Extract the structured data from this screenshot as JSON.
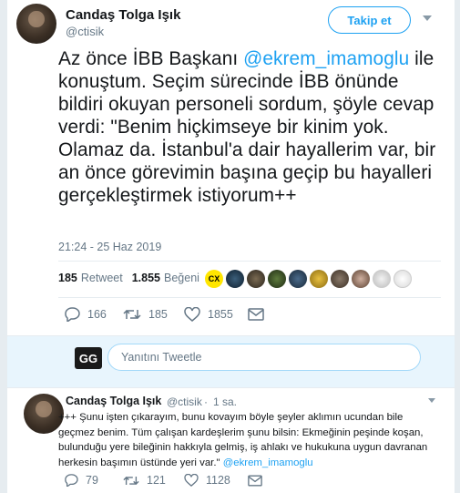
{
  "main_tweet": {
    "author_name": "Candaş Tolga Işık",
    "author_handle": "@ctisik",
    "follow_label": "Takip et",
    "text_before": "Az önce İBB Başkanı ",
    "mention": "@ekrem_imamoglu",
    "text_after": " ile konuştum. Seçim sürecinde İBB önünde bildiri okuyan personeli sordum, şöyle cevap verdi: \"Benim hiçkimseye bir kinim yok. Olamaz da. İstanbul'a dair hayallerim var, bir an önce görevimin başına geçip bu hayalleri gerçekleştirmek istiyorum++",
    "timestamp": "21:24 - 25 Haz 2019",
    "retweets_count": "185",
    "retweets_label": "Retweet",
    "likes_count": "1.855",
    "likes_label": "Beğeni",
    "liker_badge": "CX",
    "actions": {
      "reply": "166",
      "retweet": "185",
      "like": "1855"
    }
  },
  "reply_box": {
    "avatar_text": "GG",
    "placeholder": "Yanıtını Tweetle"
  },
  "reply_tweet": {
    "author_name": "Candaş Tolga Işık",
    "author_handle": "@ctisik",
    "time_ago": "1 sa.",
    "text": "+++ Şunu işten çıkarayım, bunu kovayım böyle şeyler aklımın ucundan bile geçmez benim. Tüm çalışan kardeşlerim şunu bilsin: Ekmeğinin peşinde koşan, bulunduğu yere bileğinin hakkıyla gelmiş, iş ahlakı ve hukukuna uygun davranan herkesin başımın üstünde yeri var.\" ",
    "mention": "@ekrem_imamoglu",
    "actions": {
      "reply": "79",
      "retweet": "121",
      "like": "1128"
    }
  },
  "colors": {
    "accent": "#1da1f2",
    "secondary_text": "#657786",
    "reply_box_bg": "#e8f5fd"
  }
}
